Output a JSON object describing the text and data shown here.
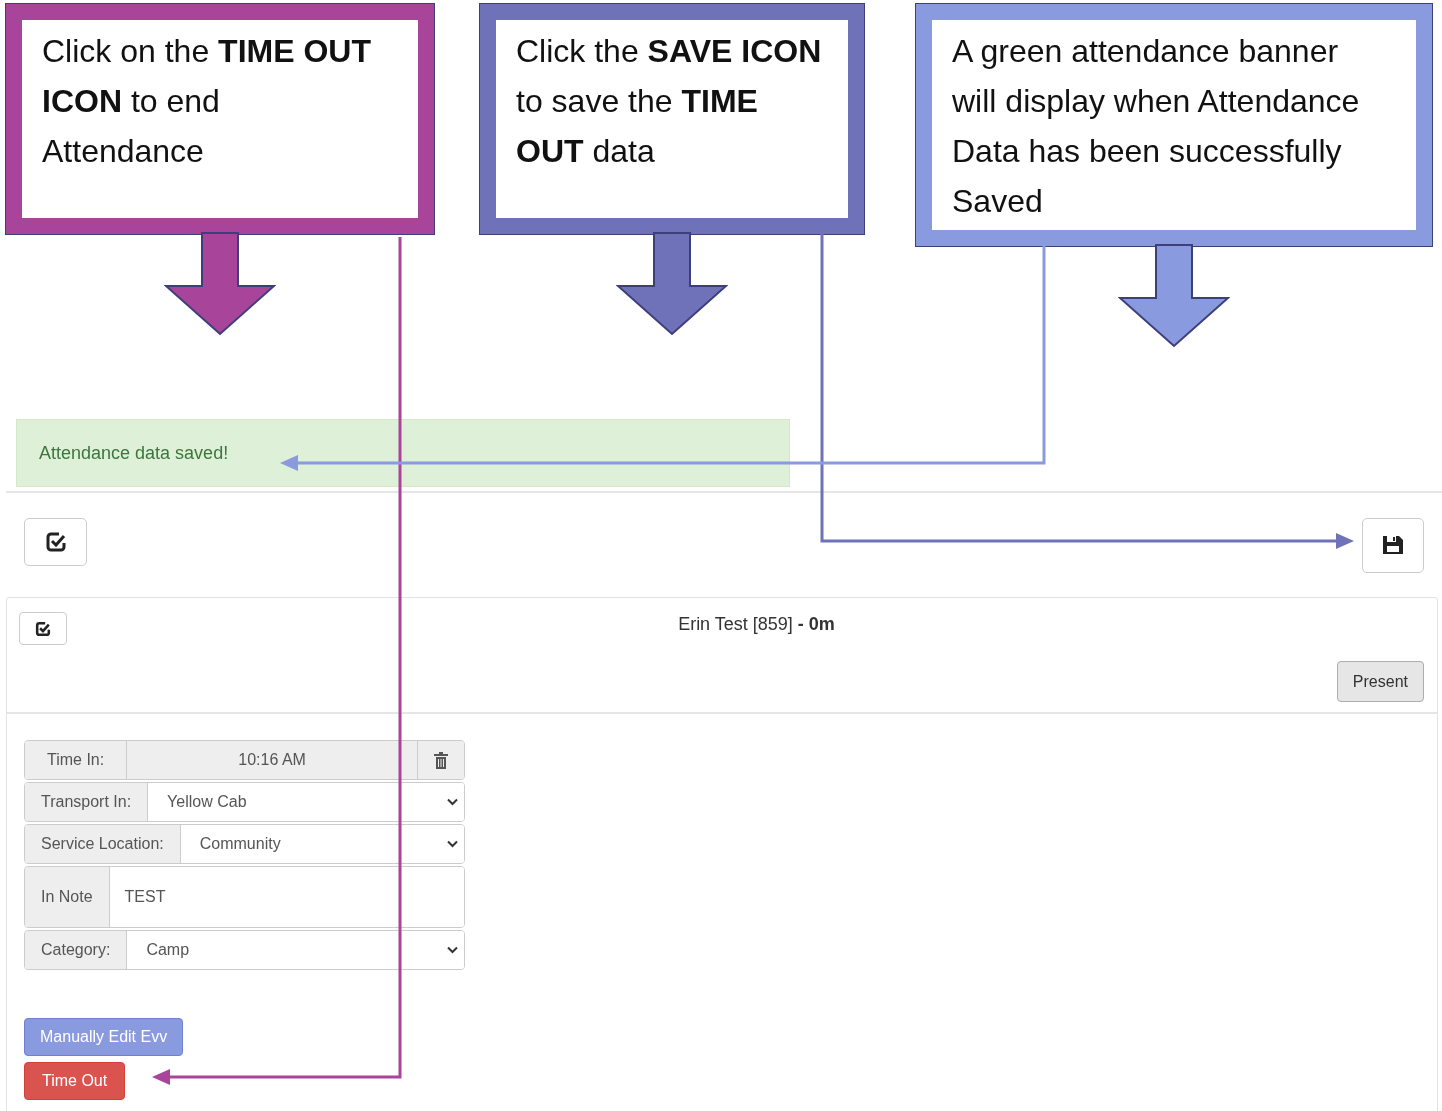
{
  "callouts": [
    {
      "text": "Click on the **TIME OUT ICON** to end Attendance",
      "color": "#a8449a"
    },
    {
      "text": "Click the **SAVE ICON** to save the **TIME OUT** data",
      "color": "#6f72b8"
    },
    {
      "text": "A green attendance banner will display when Attendance Data has been successfully Saved",
      "color": "#8a9ade"
    }
  ],
  "banner": {
    "text": "Attendance data saved!"
  },
  "record": {
    "title": "Erin Test [859] **- 0m**",
    "status_button": "Present"
  },
  "form": {
    "rows": [
      {
        "kind": "static",
        "label": "Time In:",
        "value": "10:16 AM"
      },
      {
        "kind": "select",
        "label": "Transport In:",
        "value": "Yellow Cab"
      },
      {
        "kind": "select",
        "label": "Service Location:",
        "value": "Community"
      },
      {
        "kind": "textarea",
        "label": "In Note",
        "value": "TEST"
      },
      {
        "kind": "select",
        "label": "Category:",
        "value": "Camp"
      }
    ]
  },
  "buttons": [
    {
      "label": "Manually Edit Evv",
      "kind": "primary"
    },
    {
      "label": "Time Out",
      "kind": "danger"
    }
  ]
}
